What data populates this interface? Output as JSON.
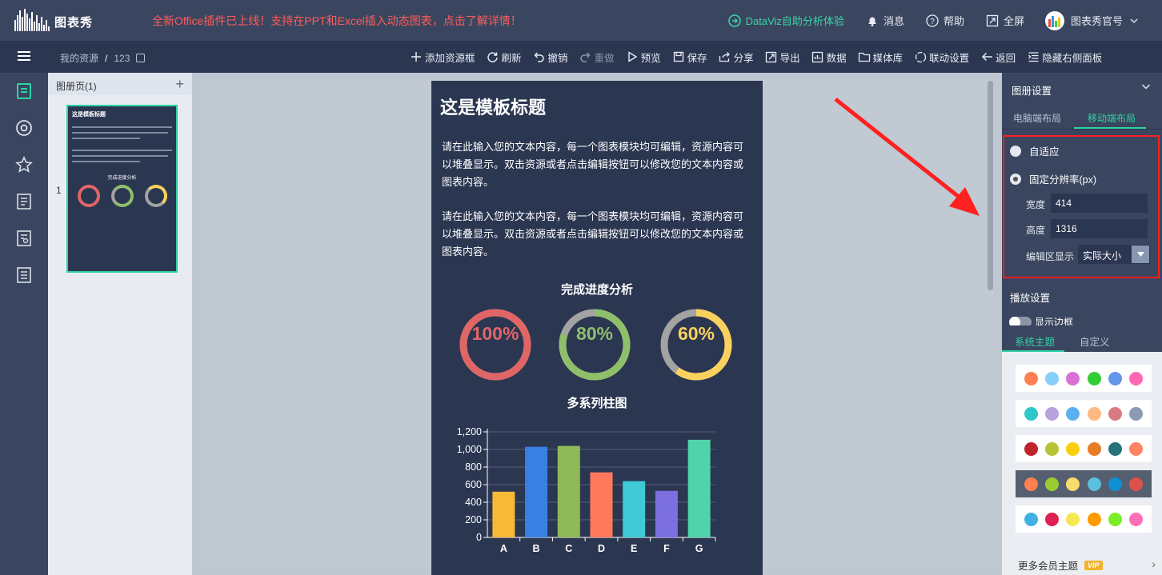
{
  "header": {
    "logo_text": "图表秀",
    "promo": "全新Office插件已上线！支持在PPT和Excel插入动态图表，点击了解详情！",
    "dataviz": "DataViz自助分析体验",
    "messages": "消息",
    "help": "帮助",
    "fullscreen": "全屏",
    "account": "图表秀官号"
  },
  "toolbar": {
    "breadcrumb_root": "我的资源",
    "breadcrumb_sep": "/",
    "breadcrumb_current": "123",
    "add_frame": "添加资源框",
    "refresh": "刷新",
    "undo": "撤销",
    "redo": "重做",
    "preview": "预览",
    "save": "保存",
    "share": "分享",
    "export": "导出",
    "data": "数据",
    "media": "媒体库",
    "linkage": "联动设置",
    "back": "返回",
    "hide_panel": "隐藏右侧面板"
  },
  "pages_panel": {
    "header": "图册页(1)",
    "add": "+",
    "page_number": "1",
    "thumb_title": "这是模板标题",
    "thumb_section": "完成进度分析"
  },
  "page": {
    "title": "这是模板标题",
    "para1": "请在此输入您的文本内容，每一个图表模块均可编辑，资源内容可以堆叠显示。双击资源或者点击编辑按钮可以修改您的文本内容或图表内容。",
    "para2": "请在此输入您的文本内容，每一个图表模块均可编辑，资源内容可以堆叠显示。双击资源或者点击编辑按钮可以修改您的文本内容或图表内容。",
    "gauge_title": "完成进度分析",
    "bar_title": "多系列柱图"
  },
  "chart_data": [
    {
      "type": "pie",
      "title": "完成进度分析",
      "values": [
        100,
        80,
        60
      ],
      "labels": [
        "100%",
        "80%",
        "60%"
      ],
      "colors": [
        "#e06666",
        "#8fbf6a",
        "#f9d15e"
      ],
      "track_color": "#a3a3a3"
    },
    {
      "type": "bar",
      "title": "多系列柱图",
      "categories": [
        "A",
        "B",
        "C",
        "D",
        "E",
        "F",
        "G"
      ],
      "values": [
        520,
        1030,
        1040,
        740,
        640,
        530,
        1110
      ],
      "colors": [
        "#f8b838",
        "#3a80e2",
        "#8fba58",
        "#ff7a5c",
        "#3fcad6",
        "#7c6fe0",
        "#4fd3a8"
      ],
      "ylim": [
        0,
        1200
      ],
      "yticks": [
        "0",
        "200",
        "400",
        "600",
        "800",
        "1,000",
        "1,200"
      ],
      "grid": true
    }
  ],
  "right_panel": {
    "section_title": "图册设置",
    "tab_pc": "电脑端布局",
    "tab_mobile": "移动端布局",
    "adaptive": "自适应",
    "fixed": "固定分辨率(px)",
    "width_label": "宽度",
    "width_value": "414",
    "height_label": "高度",
    "height_value": "1316",
    "edit_display_label": "编辑区显示",
    "edit_display_value": "实际大小",
    "play_settings": "播放设置",
    "show_border": "显示边框",
    "theme_system": "系统主题",
    "theme_custom": "自定义",
    "more_themes": "更多会员主题",
    "vip": "VIP"
  },
  "palettes": [
    [
      "#ff7f50",
      "#87cefa",
      "#da70d6",
      "#32cd32",
      "#6495ed",
      "#ff69b4"
    ],
    [
      "#2ec7c9",
      "#b6a2de",
      "#5ab1ef",
      "#ffb980",
      "#d87a80",
      "#8d98b3"
    ],
    [
      "#c1232b",
      "#b5c334",
      "#fcce10",
      "#e87c25",
      "#27727b",
      "#fe8463"
    ],
    [
      "#ff7f50",
      "#9acd32",
      "#f7dc6f",
      "#5bc0de",
      "#0e90d2",
      "#dd514c"
    ],
    [
      "#3fb1e3",
      "#e01f54",
      "#f5e851",
      "#ff9a00",
      "#7ced26",
      "#ff6fb5"
    ]
  ]
}
